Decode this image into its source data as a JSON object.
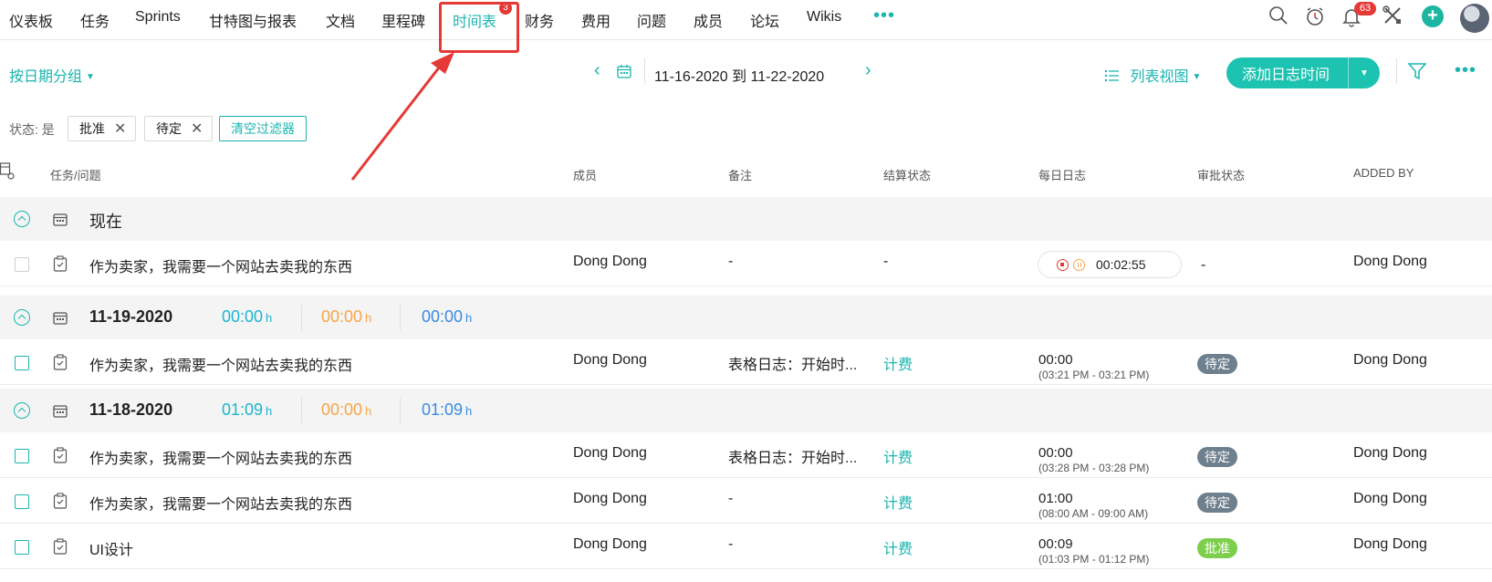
{
  "nav": {
    "items": [
      "仪表板",
      "任务",
      "Sprints",
      "甘特图与报表",
      "文档",
      "里程碑",
      "时间表",
      "财务",
      "费用",
      "问题",
      "成员",
      "论坛",
      "Wikis"
    ],
    "more": "•••",
    "timesheet_badge": "3",
    "bell_badge": "63",
    "plus": "+"
  },
  "toolbar": {
    "group_by": "按日期分组",
    "date_range": "11-16-2020 到 11-22-2020",
    "list_view": "列表视图",
    "add_button": "添加日志时间",
    "more": "•••"
  },
  "filters": {
    "status_label": "状态: 是",
    "chips": [
      "批准",
      "待定"
    ],
    "clear": "清空过滤器"
  },
  "table": {
    "headers": {
      "task": "任务/问题",
      "member": "成员",
      "note": "备注",
      "billing": "结算状态",
      "daily_log": "每日日志",
      "approval": "审批状态",
      "added_by": "ADDED BY"
    }
  },
  "groups": [
    {
      "title": "现在",
      "rows": [
        {
          "task": "作为卖家，我需要一个网站去卖我的东西",
          "member": "Dong Dong",
          "note": "-",
          "billing": "-",
          "timer": "00:02:55",
          "approval": "-",
          "added_by": "Dong Dong"
        }
      ]
    },
    {
      "title": "11-19-2020",
      "sums": [
        "00:00",
        "00:00",
        "00:00"
      ],
      "unit": "h",
      "rows": [
        {
          "task": "作为卖家，我需要一个网站去卖我的东西",
          "member": "Dong Dong",
          "note": "表格日志：开始时...",
          "billing": "计费",
          "log": "00:00",
          "log_range": "(03:21 PM - 03:21 PM)",
          "approval": "待定",
          "added_by": "Dong Dong"
        }
      ]
    },
    {
      "title": "11-18-2020",
      "sums": [
        "01:09",
        "00:00",
        "01:09"
      ],
      "unit": "h",
      "rows": [
        {
          "task": "作为卖家，我需要一个网站去卖我的东西",
          "member": "Dong Dong",
          "note": "表格日志：开始时...",
          "billing": "计费",
          "log": "00:00",
          "log_range": "(03:28 PM - 03:28 PM)",
          "approval": "待定",
          "added_by": "Dong Dong"
        },
        {
          "task": "作为卖家，我需要一个网站去卖我的东西",
          "member": "Dong Dong",
          "note": "-",
          "billing": "计费",
          "log": "01:00",
          "log_range": "(08:00 AM - 09:00 AM)",
          "approval": "待定",
          "added_by": "Dong Dong"
        },
        {
          "task": "UI设计",
          "member": "Dong Dong",
          "note": "-",
          "billing": "计费",
          "log": "00:09",
          "log_range": "(01:03 PM - 01:12 PM)",
          "approval": "批准",
          "added_by": "Dong Dong"
        }
      ]
    }
  ],
  "colors": {
    "accent": "#1bb5b0",
    "pending": "#6e7f8d",
    "approved": "#7ccf4a",
    "highlight": "#e53935"
  }
}
